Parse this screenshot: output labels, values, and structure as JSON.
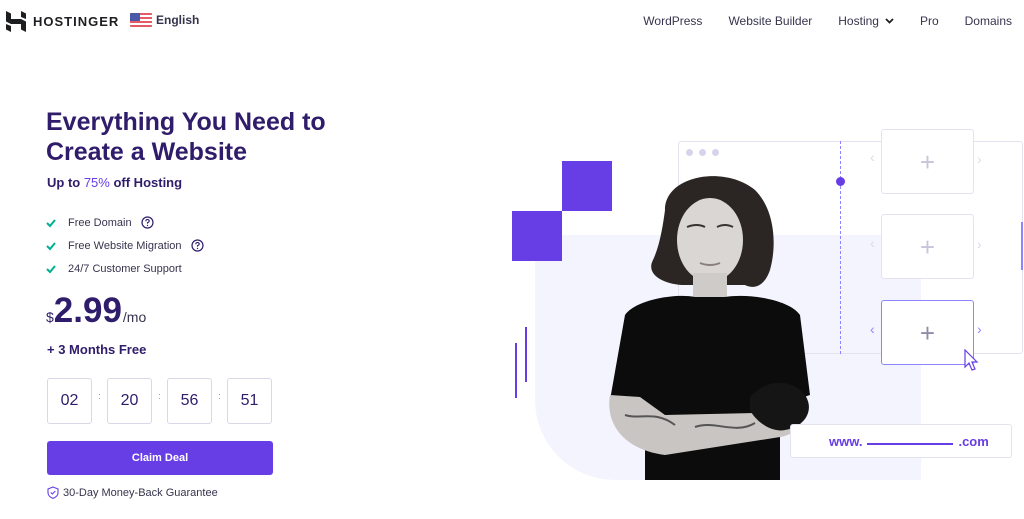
{
  "header": {
    "brand": "HOSTINGER",
    "language": "English",
    "nav": [
      {
        "label": "WordPress"
      },
      {
        "label": "Website Builder"
      },
      {
        "label": "Hosting",
        "has_dropdown": true
      },
      {
        "label": "Pro"
      },
      {
        "label": "Domains"
      }
    ]
  },
  "hero": {
    "title": "Everything You Need to Create a Website",
    "subtitle_prefix": "Up to ",
    "subtitle_accent": "75%",
    "subtitle_suffix": " off Hosting",
    "features": [
      {
        "label": "Free Domain",
        "help": true
      },
      {
        "label": "Free Website Migration",
        "help": true
      },
      {
        "label": "24/7 Customer Support",
        "help": false
      }
    ],
    "price": {
      "currency": "$",
      "value": "2.99",
      "period": "/mo"
    },
    "bonus": "+ 3 Months Free",
    "countdown": {
      "days": "02",
      "hours": "20",
      "minutes": "56",
      "seconds": "51",
      "separator": ":"
    },
    "cta_label": "Claim Deal",
    "guarantee": "30-Day Money-Back Guarantee"
  },
  "illustration": {
    "domain_prefix": "www.",
    "domain_suffix": ".com",
    "plus_symbol": "+",
    "arrow_left": "‹",
    "arrow_right": "›"
  },
  "colors": {
    "brand": "#673de6",
    "heading": "#2f1c6a",
    "check": "#00b090",
    "accent_light": "#8c85ff",
    "bg_soft": "#f4f4ff"
  }
}
